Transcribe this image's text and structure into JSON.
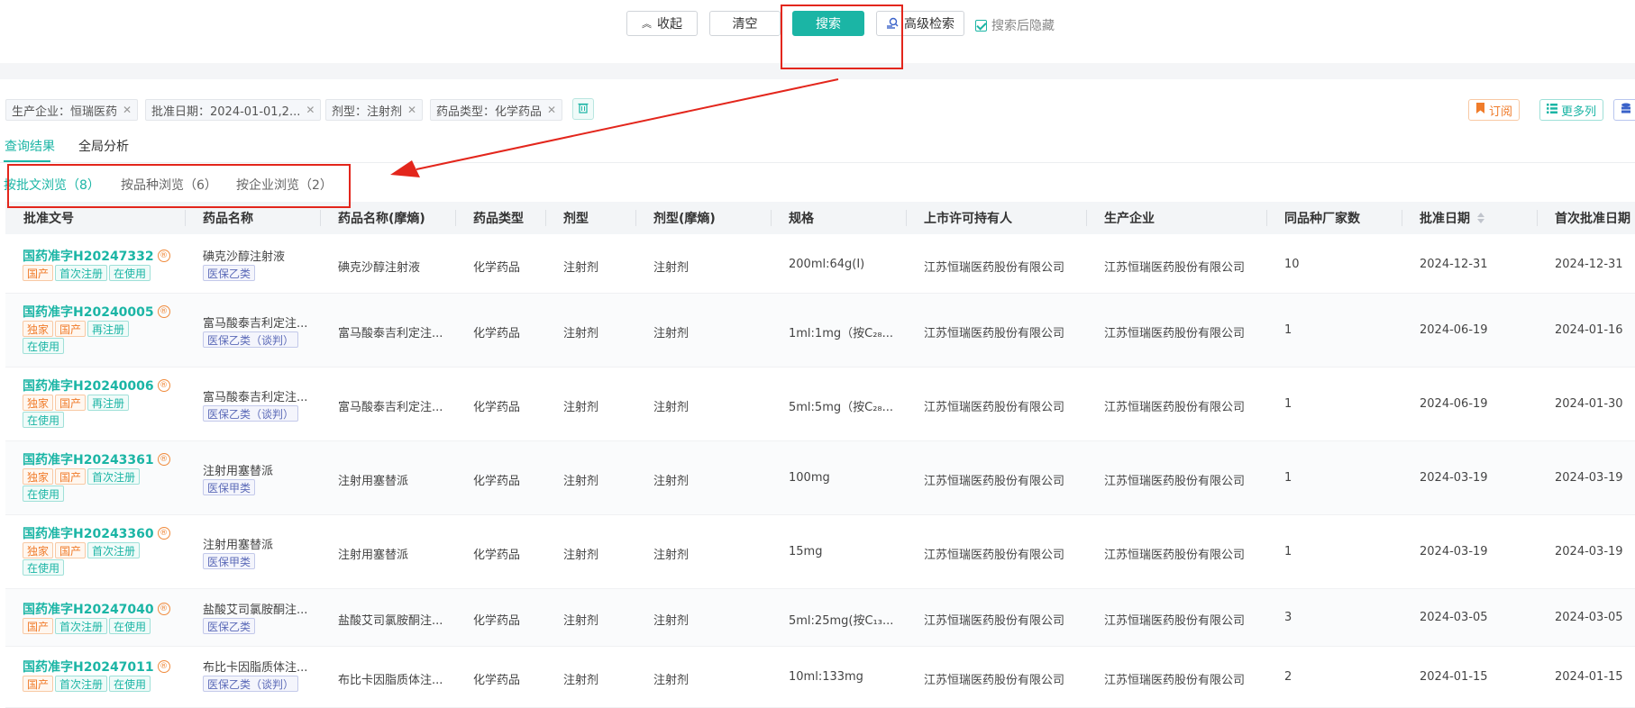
{
  "toolbar": {
    "collapse_label": "收起",
    "clear_label": "清空",
    "search_label": "搜索",
    "advanced_label": "高级检索",
    "hide_after_search_label": "搜索后隐藏"
  },
  "filters": [
    {
      "label": "生产企业：恒瑞医药"
    },
    {
      "label": "批准日期：2024-01-01,2..."
    },
    {
      "label": "剂型：注射剂"
    },
    {
      "label": "药品类型：化学药品"
    }
  ],
  "actions": {
    "subscribe_label": "订阅",
    "more_columns_label": "更多列"
  },
  "main_tabs": [
    {
      "label": "查询结果",
      "active": true
    },
    {
      "label": "全局分析",
      "active": false
    }
  ],
  "browse_tabs": [
    {
      "label": "按批文浏览（8）",
      "active": true
    },
    {
      "label": "按品种浏览（6）",
      "active": false
    },
    {
      "label": "按企业浏览（2）",
      "active": false
    }
  ],
  "table": {
    "headers": [
      "批准文号",
      "药品名称",
      "药品名称(摩熵)",
      "药品类型",
      "剂型",
      "剂型(摩熵)",
      "规格",
      "上市许可持有人",
      "生产企业",
      "同品种厂家数",
      "批准日期",
      "首次批准日期"
    ],
    "rows": [
      {
        "approval_no": "国药准字H20247332",
        "tags": [
          "国产",
          "首次注册",
          "在使用"
        ],
        "drug_name": "碘克沙醇注射液",
        "insurance": "医保乙类",
        "name_moshang": "碘克沙醇注射液",
        "type": "化学药品",
        "dosage": "注射剂",
        "dosage_moshang": "注射剂",
        "spec": "200ml:64g(I)",
        "holder": "江苏恒瑞医药股份有限公司",
        "manufacturer": "江苏恒瑞医药股份有限公司",
        "count": "10",
        "approval_date": "2024-12-31",
        "first_date": "2024-12-31"
      },
      {
        "approval_no": "国药准字H20240005",
        "tags": [
          "独家",
          "国产",
          "再注册",
          "在使用"
        ],
        "drug_name": "富马酸泰吉利定注...",
        "insurance": "医保乙类（谈判）",
        "name_moshang": "富马酸泰吉利定注...",
        "type": "化学药品",
        "dosage": "注射剂",
        "dosage_moshang": "注射剂",
        "spec": "1ml:1mg（按C₂₈...",
        "holder": "江苏恒瑞医药股份有限公司",
        "manufacturer": "江苏恒瑞医药股份有限公司",
        "count": "1",
        "approval_date": "2024-06-19",
        "first_date": "2024-01-16"
      },
      {
        "approval_no": "国药准字H20240006",
        "tags": [
          "独家",
          "国产",
          "再注册",
          "在使用"
        ],
        "drug_name": "富马酸泰吉利定注...",
        "insurance": "医保乙类（谈判）",
        "name_moshang": "富马酸泰吉利定注...",
        "type": "化学药品",
        "dosage": "注射剂",
        "dosage_moshang": "注射剂",
        "spec": "5ml:5mg（按C₂₈...",
        "holder": "江苏恒瑞医药股份有限公司",
        "manufacturer": "江苏恒瑞医药股份有限公司",
        "count": "1",
        "approval_date": "2024-06-19",
        "first_date": "2024-01-30"
      },
      {
        "approval_no": "国药准字H20243361",
        "tags": [
          "独家",
          "国产",
          "首次注册",
          "在使用"
        ],
        "drug_name": "注射用塞替派",
        "insurance": "医保甲类",
        "name_moshang": "注射用塞替派",
        "type": "化学药品",
        "dosage": "注射剂",
        "dosage_moshang": "注射剂",
        "spec": "100mg",
        "holder": "江苏恒瑞医药股份有限公司",
        "manufacturer": "江苏恒瑞医药股份有限公司",
        "count": "1",
        "approval_date": "2024-03-19",
        "first_date": "2024-03-19"
      },
      {
        "approval_no": "国药准字H20243360",
        "tags": [
          "独家",
          "国产",
          "首次注册",
          "在使用"
        ],
        "drug_name": "注射用塞替派",
        "insurance": "医保甲类",
        "name_moshang": "注射用塞替派",
        "type": "化学药品",
        "dosage": "注射剂",
        "dosage_moshang": "注射剂",
        "spec": "15mg",
        "holder": "江苏恒瑞医药股份有限公司",
        "manufacturer": "江苏恒瑞医药股份有限公司",
        "count": "1",
        "approval_date": "2024-03-19",
        "first_date": "2024-03-19"
      },
      {
        "approval_no": "国药准字H20247040",
        "tags": [
          "国产",
          "首次注册",
          "在使用"
        ],
        "drug_name": "盐酸艾司氯胺酮注...",
        "insurance": "医保乙类",
        "name_moshang": "盐酸艾司氯胺酮注...",
        "type": "化学药品",
        "dosage": "注射剂",
        "dosage_moshang": "注射剂",
        "spec": "5ml:25mg(按C₁₃...",
        "holder": "江苏恒瑞医药股份有限公司",
        "manufacturer": "江苏恒瑞医药股份有限公司",
        "count": "3",
        "approval_date": "2024-03-05",
        "first_date": "2024-03-05"
      },
      {
        "approval_no": "国药准字H20247011",
        "tags": [
          "国产",
          "首次注册",
          "在使用"
        ],
        "drug_name": "布比卡因脂质体注...",
        "insurance": "医保乙类（谈判）",
        "name_moshang": "布比卡因脂质体注...",
        "type": "化学药品",
        "dosage": "注射剂",
        "dosage_moshang": "注射剂",
        "spec": "10ml:133mg",
        "holder": "江苏恒瑞医药股份有限公司",
        "manufacturer": "江苏恒瑞医药股份有限公司",
        "count": "2",
        "approval_date": "2024-01-15",
        "first_date": "2024-01-15"
      }
    ]
  },
  "colors": {
    "accent": "#1bb5a5",
    "tag_orange": "#f07c2b",
    "tag_purple": "#5b6ab8",
    "annotation_red": "#e3261c"
  }
}
